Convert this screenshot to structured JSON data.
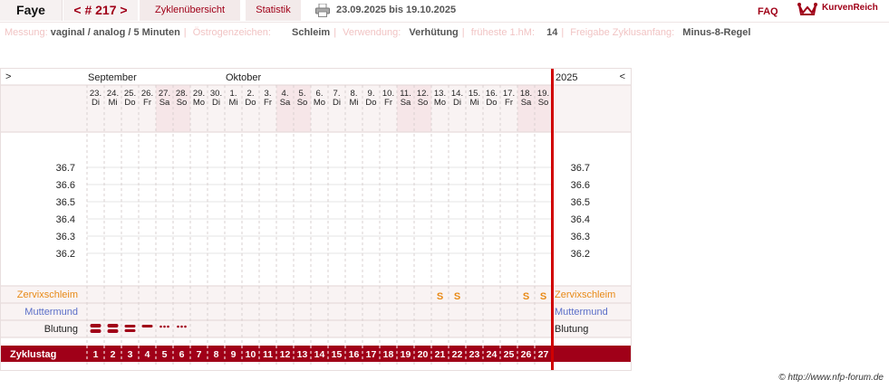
{
  "header": {
    "name": "Faye",
    "cycle": "< # 217 >",
    "tabs": [
      {
        "label": "Zyklenübersicht"
      },
      {
        "label": "Statistik"
      }
    ],
    "date_range": "23.09.2025 bis 19.10.2025",
    "faq": "FAQ",
    "logo_text": "KurvenReich"
  },
  "settings": [
    {
      "label": "Messung:",
      "value": "vaginal / analog / 5 Minuten"
    },
    {
      "label": "Östrogenzeichen:",
      "value": "Schleim"
    },
    {
      "label": "Verwendung:",
      "value": "Verhütung"
    },
    {
      "label": "früheste 1.hM:",
      "value": "14"
    },
    {
      "label": "Freigabe Zyklusanfang:",
      "value": "Minus-8-Regel"
    }
  ],
  "chart_data": {
    "type": "table",
    "nav_left": ">",
    "nav_right": "<",
    "year": "2025",
    "months": [
      {
        "name": "September",
        "start_index": 0
      },
      {
        "name": "Oktober",
        "start_index": 8
      }
    ],
    "days": [
      {
        "date": "23.",
        "wd": "Di",
        "cycle_day": "1",
        "weekend": false,
        "mucus": "",
        "bleeding": "heavy"
      },
      {
        "date": "24.",
        "wd": "Mi",
        "cycle_day": "2",
        "weekend": false,
        "mucus": "",
        "bleeding": "heavy"
      },
      {
        "date": "25.",
        "wd": "Do",
        "cycle_day": "3",
        "weekend": false,
        "mucus": "",
        "bleeding": "medium"
      },
      {
        "date": "26.",
        "wd": "Fr",
        "cycle_day": "4",
        "weekend": false,
        "mucus": "",
        "bleeding": "light"
      },
      {
        "date": "27.",
        "wd": "Sa",
        "cycle_day": "5",
        "weekend": true,
        "mucus": "",
        "bleeding": "spotting"
      },
      {
        "date": "28.",
        "wd": "So",
        "cycle_day": "6",
        "weekend": true,
        "mucus": "",
        "bleeding": "spotting"
      },
      {
        "date": "29.",
        "wd": "Mo",
        "cycle_day": "7",
        "weekend": false,
        "mucus": "",
        "bleeding": ""
      },
      {
        "date": "30.",
        "wd": "Di",
        "cycle_day": "8",
        "weekend": false,
        "mucus": "",
        "bleeding": ""
      },
      {
        "date": "1.",
        "wd": "Mi",
        "cycle_day": "9",
        "weekend": false,
        "mucus": "",
        "bleeding": ""
      },
      {
        "date": "2.",
        "wd": "Do",
        "cycle_day": "10",
        "weekend": false,
        "mucus": "",
        "bleeding": ""
      },
      {
        "date": "3.",
        "wd": "Fr",
        "cycle_day": "11",
        "weekend": false,
        "mucus": "",
        "bleeding": ""
      },
      {
        "date": "4.",
        "wd": "Sa",
        "cycle_day": "12",
        "weekend": true,
        "mucus": "",
        "bleeding": ""
      },
      {
        "date": "5.",
        "wd": "So",
        "cycle_day": "13",
        "weekend": true,
        "mucus": "",
        "bleeding": ""
      },
      {
        "date": "6.",
        "wd": "Mo",
        "cycle_day": "14",
        "weekend": false,
        "mucus": "",
        "bleeding": ""
      },
      {
        "date": "7.",
        "wd": "Di",
        "cycle_day": "15",
        "weekend": false,
        "mucus": "",
        "bleeding": ""
      },
      {
        "date": "8.",
        "wd": "Mi",
        "cycle_day": "16",
        "weekend": false,
        "mucus": "",
        "bleeding": ""
      },
      {
        "date": "9.",
        "wd": "Do",
        "cycle_day": "17",
        "weekend": false,
        "mucus": "",
        "bleeding": ""
      },
      {
        "date": "10.",
        "wd": "Fr",
        "cycle_day": "18",
        "weekend": false,
        "mucus": "",
        "bleeding": ""
      },
      {
        "date": "11.",
        "wd": "Sa",
        "cycle_day": "19",
        "weekend": true,
        "mucus": "",
        "bleeding": ""
      },
      {
        "date": "12.",
        "wd": "So",
        "cycle_day": "20",
        "weekend": true,
        "mucus": "",
        "bleeding": ""
      },
      {
        "date": "13.",
        "wd": "Mo",
        "cycle_day": "21",
        "weekend": false,
        "mucus": "S",
        "bleeding": ""
      },
      {
        "date": "14.",
        "wd": "Di",
        "cycle_day": "22",
        "weekend": false,
        "mucus": "S",
        "bleeding": ""
      },
      {
        "date": "15.",
        "wd": "Mi",
        "cycle_day": "23",
        "weekend": false,
        "mucus": "",
        "bleeding": ""
      },
      {
        "date": "16.",
        "wd": "Do",
        "cycle_day": "24",
        "weekend": false,
        "mucus": "",
        "bleeding": ""
      },
      {
        "date": "17.",
        "wd": "Fr",
        "cycle_day": "25",
        "weekend": false,
        "mucus": "",
        "bleeding": ""
      },
      {
        "date": "18.",
        "wd": "Sa",
        "cycle_day": "26",
        "weekend": true,
        "mucus": "S",
        "bleeding": ""
      },
      {
        "date": "19.",
        "wd": "So",
        "cycle_day": "27",
        "weekend": true,
        "mucus": "S",
        "bleeding": ""
      }
    ],
    "temp_axis": [
      "36.7",
      "36.6",
      "36.5",
      "36.4",
      "36.3",
      "36.2"
    ],
    "rows": {
      "mucus": "Zervixschleim",
      "cervix": "Muttermund",
      "bleeding": "Blutung",
      "cycle_day": "Zyklustag"
    },
    "colors": {
      "accent": "#a00018",
      "mucus": "#e88a17",
      "cervix": "#5b6fc8",
      "weekend": "#f6e6e8",
      "today_line": "#d00000"
    }
  },
  "footer": "© http://www.nfp-forum.de"
}
